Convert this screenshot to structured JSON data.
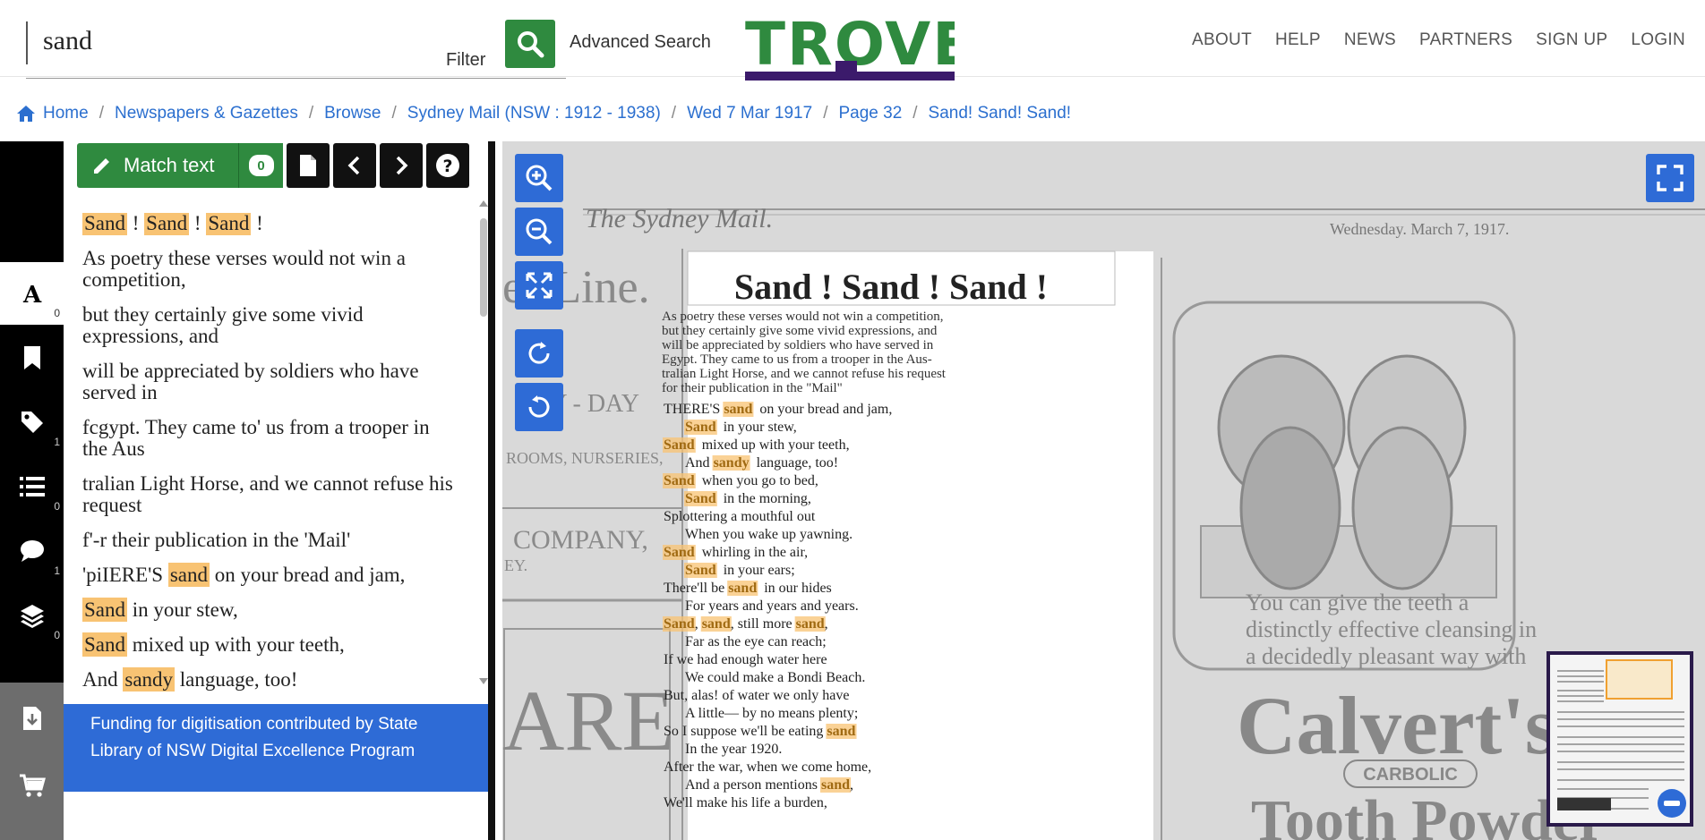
{
  "search": {
    "value": "sand",
    "filter_label": "Filter",
    "advanced_label": "Advanced Search"
  },
  "logo": {
    "text": "TROVE",
    "color": "#2f8a3f",
    "bar_color": "#3b1a6b"
  },
  "top_nav": [
    "ABOUT",
    "HELP",
    "NEWS",
    "PARTNERS",
    "SIGN UP",
    "LOGIN"
  ],
  "breadcrumb": [
    "Home",
    "Newspapers & Gazettes",
    "Browse",
    "Sydney Mail (NSW : 1912 - 1938)",
    "Wed 7 Mar 1917",
    "Page 32",
    "Sand! Sand! Sand!"
  ],
  "rail": {
    "items": [
      {
        "icon": "text-icon",
        "count": "0"
      },
      {
        "icon": "bookmark-icon",
        "count": ""
      },
      {
        "icon": "tag-icon",
        "count": "1"
      },
      {
        "icon": "list-icon",
        "count": "0"
      },
      {
        "icon": "comment-icon",
        "count": "1"
      },
      {
        "icon": "layers-icon",
        "count": "0"
      },
      {
        "icon": "download-icon",
        "count": ""
      },
      {
        "icon": "cart-icon",
        "count": ""
      }
    ]
  },
  "toolbar": {
    "match_label": "Match text",
    "match_count": "0"
  },
  "article_lines": [
    [
      [
        "Sand",
        true
      ],
      [
        " ! ",
        false
      ],
      [
        "Sand",
        true
      ],
      [
        " ! ",
        false
      ],
      [
        "Sand",
        true
      ],
      [
        " !",
        false
      ]
    ],
    [
      [
        "As poetry these verses would not win a competition,",
        false
      ]
    ],
    [
      [
        "but they certainly give some vivid expressions, and",
        false
      ]
    ],
    [
      [
        "will be appreciated by soldiers who have served in",
        false
      ]
    ],
    [
      [
        "fcgypt. They came to' us from a trooper in the Aus",
        false
      ]
    ],
    [
      [
        "tralian Light Horse, and we cannot refuse his request",
        false
      ]
    ],
    [
      [
        "f'-r their publication in the 'Mail'",
        false
      ]
    ],
    [
      [
        "'piIERE'S ",
        false
      ],
      [
        "sand",
        true
      ],
      [
        " on your bread and jam,",
        false
      ]
    ],
    [
      [
        "Sand",
        true
      ],
      [
        " in your stew,",
        false
      ]
    ],
    [
      [
        "Sand",
        true
      ],
      [
        " mixed up with your teeth,",
        false
      ]
    ],
    [
      [
        "And ",
        false
      ],
      [
        "sandy",
        true
      ],
      [
        " language, too!",
        false
      ]
    ]
  ],
  "funding": "Funding for digitisation contributed by State Library of NSW Digital Excellence Program",
  "newspaper": {
    "masthead": "The Sydney Mail.",
    "date": "Wednesday. March 7, 1917.",
    "headline": "Sand ! Sand ! Sand !",
    "intro": [
      "As poetry these verses would not win a competition,",
      "but they certainly give some vivid expressions, and",
      "will be appreciated by soldiers who have served in",
      "Egypt.   They came to us from a trooper in the Aus-",
      "tralian Light Horse, and we cannot refuse his request",
      "for their publication in the \"Mail\""
    ],
    "poem": [
      [
        [
          "THERE'S ",
          false
        ],
        [
          "sand",
          true
        ],
        [
          " on your bread and jam,",
          false
        ]
      ],
      [
        [
          "   ",
          false
        ],
        [
          "Sand",
          true
        ],
        [
          " in your stew,",
          false
        ]
      ],
      [
        [
          "Sand",
          true
        ],
        [
          " mixed up with your teeth,",
          false
        ]
      ],
      [
        [
          "   And ",
          false
        ],
        [
          "sandy",
          true
        ],
        [
          " language, too!",
          false
        ]
      ],
      [
        [
          "Sand",
          true
        ],
        [
          " when you go to bed,",
          false
        ]
      ],
      [
        [
          "   ",
          false
        ],
        [
          "Sand",
          true
        ],
        [
          " in the morning,",
          false
        ]
      ],
      [
        [
          "Splottering a mouthful out",
          false
        ]
      ],
      [
        [
          "   When you wake up yawning.",
          false
        ]
      ],
      [
        [
          "Sand",
          true
        ],
        [
          " whirling in the air,",
          false
        ]
      ],
      [
        [
          "   ",
          false
        ],
        [
          "Sand",
          true
        ],
        [
          " in your ears;",
          false
        ]
      ],
      [
        [
          "There'll be ",
          false
        ],
        [
          "sand",
          true
        ],
        [
          " in our hides",
          false
        ]
      ],
      [
        [
          "   For years and years and years.",
          false
        ]
      ],
      [
        [
          "Sand",
          true
        ],
        [
          ", ",
          false
        ],
        [
          "sand",
          true
        ],
        [
          ", still more ",
          false
        ],
        [
          "sand",
          true
        ],
        [
          ",",
          false
        ]
      ],
      [
        [
          "   Far as the eye can reach;",
          false
        ]
      ],
      [
        [
          "If we had enough water here",
          false
        ]
      ],
      [
        [
          "   We could make a Bondi Beach.",
          false
        ]
      ],
      [
        [
          "But, alas! of water we only have",
          false
        ]
      ],
      [
        [
          "   A little— by no means plenty;",
          false
        ]
      ],
      [
        [
          "So I suppose we'll be eating ",
          false
        ],
        [
          "sand",
          true
        ]
      ],
      [
        [
          "   In the year 1920.",
          false
        ]
      ],
      [
        [
          "After the war, when we come home,",
          false
        ]
      ],
      [
        [
          "   And a person mentions ",
          false
        ],
        [
          "sand",
          true
        ],
        [
          ",",
          false
        ]
      ],
      [
        [
          "We'll make his life a burden,",
          false
        ]
      ]
    ],
    "left_column": [
      "es Line.",
      "T.",
      "RAY - DAY",
      "ROOMS, NURSERIES,",
      "COMPANY,",
      "EY.",
      "ARE"
    ],
    "ad_text": [
      "You can give the teeth a",
      "distinctly effective cleansing in",
      "a decidedly pleasant way with"
    ],
    "ad_brand": "Calvert's",
    "ad_carbolic": "CARBOLIC",
    "ad_product": "Tooth Powder"
  },
  "colors": {
    "green": "#2f8a3f",
    "blue": "#2e6bd6",
    "highlight": "#f8c373",
    "link": "#2b6fcf"
  }
}
